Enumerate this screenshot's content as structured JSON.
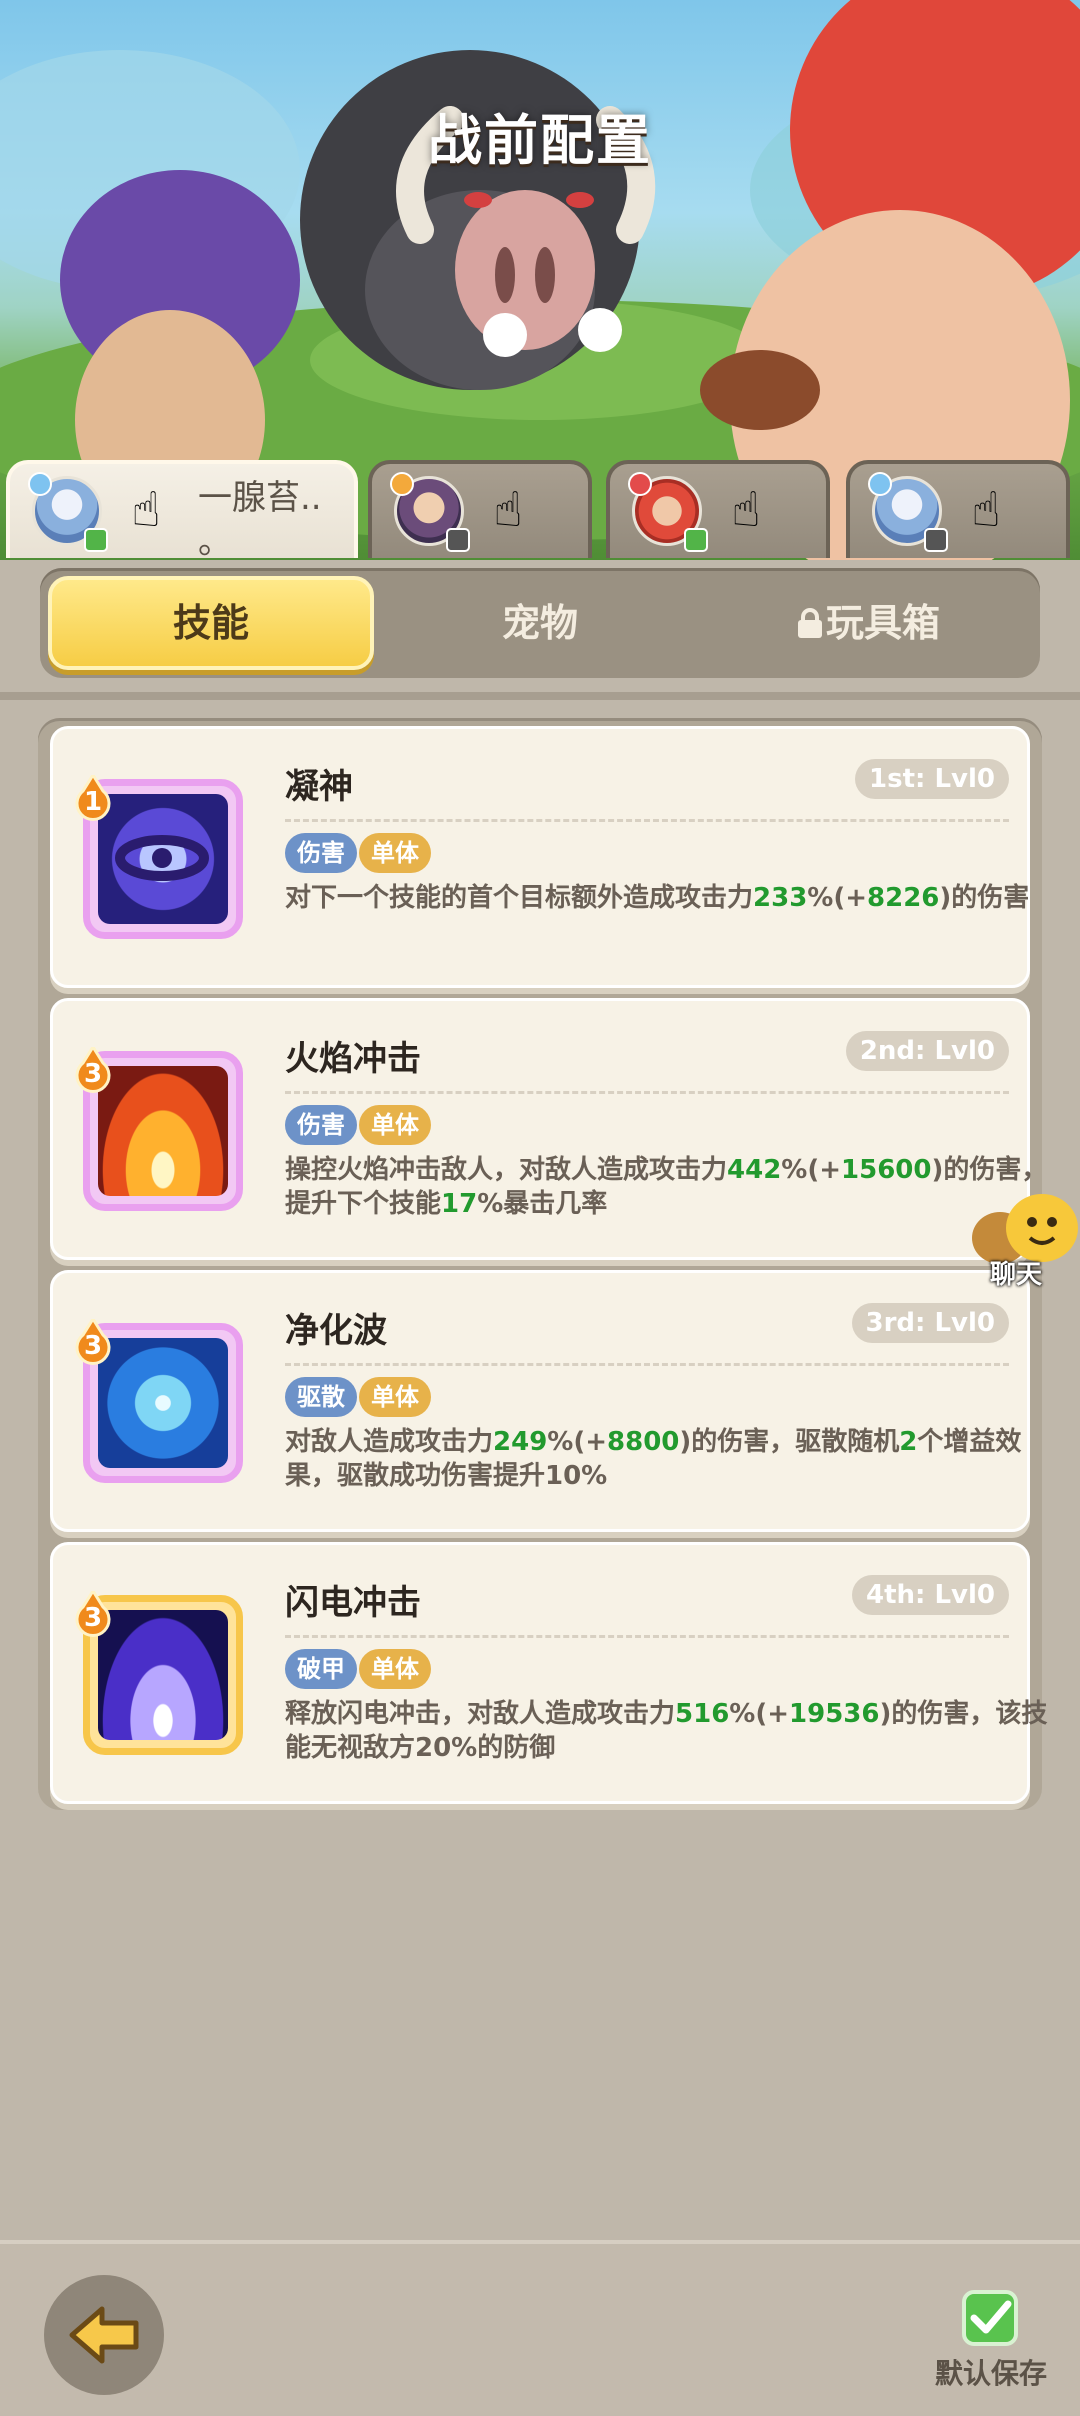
{
  "header": {
    "title": "战前配置"
  },
  "slots": [
    {
      "name": "一腺苔..\n。",
      "active": true
    },
    {
      "name": "",
      "active": false
    },
    {
      "name": "",
      "active": false
    },
    {
      "name": "",
      "active": false
    }
  ],
  "tabs": [
    {
      "label": "技能",
      "active": true
    },
    {
      "label": "宠物",
      "active": false
    },
    {
      "label": "玩具箱",
      "active": false,
      "locked": true
    }
  ],
  "skills": [
    {
      "name": "凝神",
      "level": "1st: Lvl0",
      "star": "1",
      "tags": [
        "伤害",
        "单体"
      ],
      "desc": [
        "对下一个技能的首个目标额外造成攻击力",
        "233",
        "%(+",
        "8226",
        ")的伤害"
      ]
    },
    {
      "name": "火焰冲击",
      "level": "2nd: Lvl0",
      "star": "3",
      "tags": [
        "伤害",
        "单体"
      ],
      "desc": [
        "操控火焰冲击敌人，对敌人造成攻击力",
        "442",
        "%(+",
        "15600",
        ")的伤害，提升下个技能",
        "17",
        "%暴击几率"
      ]
    },
    {
      "name": "净化波",
      "level": "3rd: Lvl0",
      "star": "3",
      "tags": [
        "驱散",
        "单体"
      ],
      "desc": [
        "对敌人造成攻击力",
        "249",
        "%(+",
        "8800",
        ")的伤害，驱散随机",
        "2",
        "个增益效果，驱散成功伤害提升10%"
      ]
    },
    {
      "name": "闪电冲击",
      "level": "4th: Lvl0",
      "star": "3",
      "tags": [
        "破甲",
        "单体"
      ],
      "desc": [
        "释放闪电冲击，对敌人造成攻击力",
        "516",
        "%(+",
        "19536",
        ")的伤害，该技能无视敌方20%的防御"
      ]
    }
  ],
  "chat": {
    "label": "聊天"
  },
  "footer": {
    "save_label": "默认保存",
    "save_checked": true
  },
  "colors": {
    "highlight_number": "#229a2e",
    "tab_active": "#f6cd45",
    "tag_blue": "#6d92c8",
    "tag_orange": "#e7b24a"
  }
}
